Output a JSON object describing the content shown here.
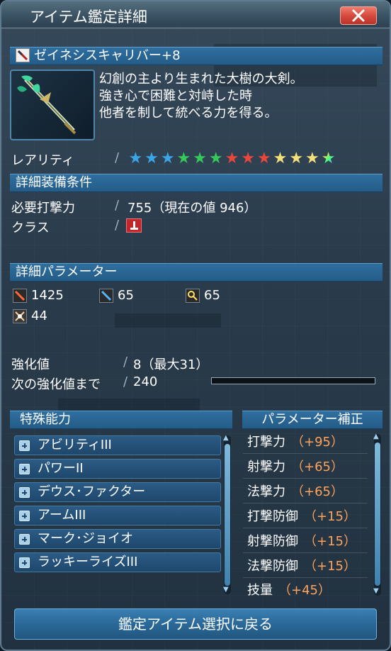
{
  "window": {
    "title": "アイテム鑑定詳細"
  },
  "weapon": {
    "name": "ゼイネシスキャリバー+8",
    "description": [
      "幻創の主より生まれた大樹の大剣。",
      "強き心で困難と対峙した時",
      "他者を制して統べる力を得る。"
    ]
  },
  "rarity": {
    "label": "レアリティ",
    "stars": 13,
    "star_colors": [
      "#3aa6e6",
      "#3aa6e6",
      "#3aa6e6",
      "#36c95a",
      "#36c95a",
      "#36c95a",
      "#e8473a",
      "#e8473a",
      "#e8473a",
      "#f3e07a",
      "#f3e07a",
      "#f3e07a",
      "#ffffff"
    ]
  },
  "requirements": {
    "header": "詳細装備条件",
    "power_label": "必要打撃力",
    "power_value": "755（現在の値 946）",
    "class_label": "クラス"
  },
  "parameters": {
    "header": "詳細パラメーター",
    "values": [
      {
        "icon": "striking-icon",
        "value": "1425"
      },
      {
        "icon": "ranged-icon",
        "value": "65"
      },
      {
        "icon": "technique-icon",
        "value": "65"
      },
      {
        "icon": "dexterity-icon",
        "value": "44"
      }
    ]
  },
  "enhancement": {
    "level_label": "強化値",
    "level_value": "8（最大31）",
    "next_label": "次の強化値まで",
    "next_value": "240",
    "progress_fraction": 0.0
  },
  "special_abilities": {
    "header": "特殊能力",
    "items": [
      "アビリティIII",
      "パワーII",
      "デウス･ファクター",
      "アームIII",
      "マーク･ジョイオ",
      "ラッキーライズIII"
    ]
  },
  "parameter_bonus": {
    "header": "パラメーター補正",
    "items": [
      {
        "name": "打撃力",
        "value": "（+95）"
      },
      {
        "name": "射撃力",
        "value": "（+65）"
      },
      {
        "name": "法撃力",
        "value": "（+65）"
      },
      {
        "name": "打撃防御",
        "value": "（+15）"
      },
      {
        "name": "射撃防御",
        "value": "（+15）"
      },
      {
        "name": "法撃防御",
        "value": "（+15）"
      },
      {
        "name": "技量",
        "value": "（+45）"
      }
    ]
  },
  "footer": {
    "return_label": "鑑定アイテム選択に戻る"
  }
}
